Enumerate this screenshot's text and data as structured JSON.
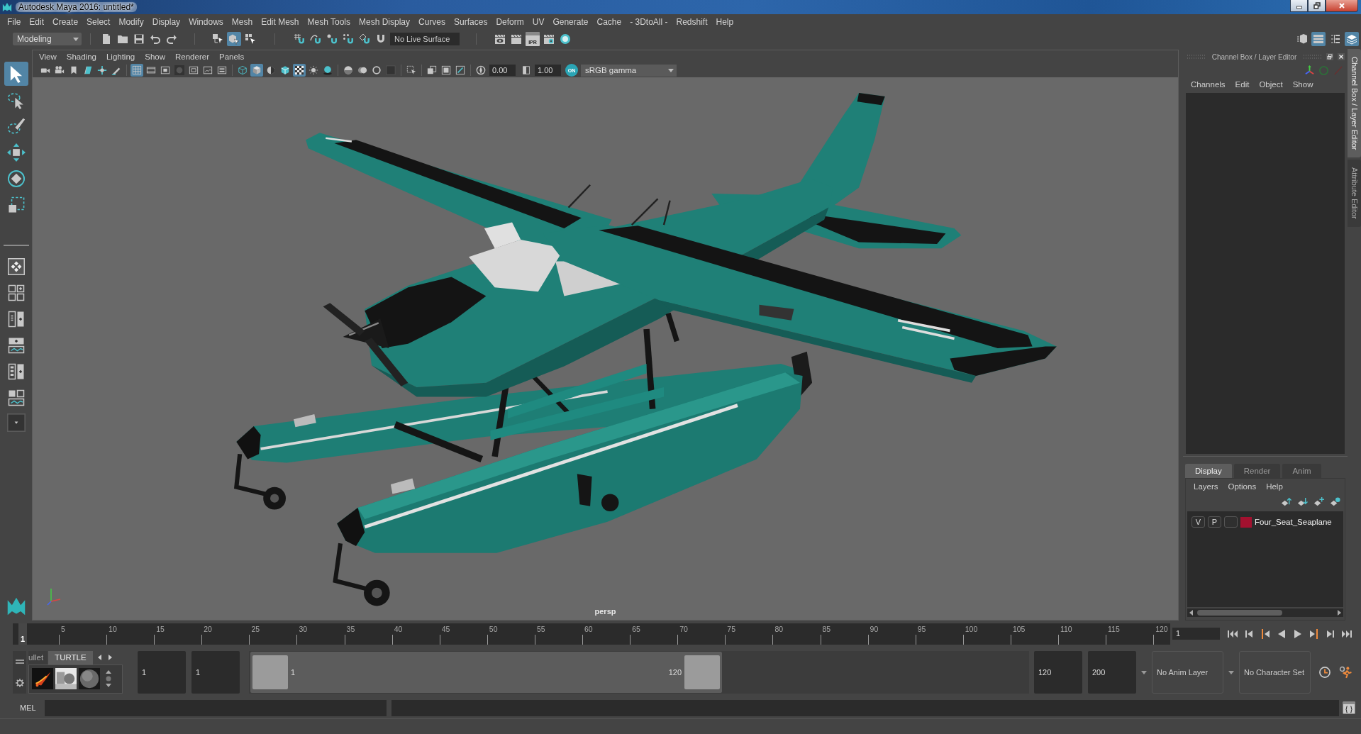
{
  "window": {
    "title": "Autodesk Maya 2016: untitled*"
  },
  "menu_bar": [
    "File",
    "Edit",
    "Create",
    "Select",
    "Modify",
    "Display",
    "Windows",
    "Mesh",
    "Edit Mesh",
    "Mesh Tools",
    "Mesh Display",
    "Curves",
    "Surfaces",
    "Deform",
    "UV",
    "Generate",
    "Cache",
    "- 3DtoAll -",
    "Redshift",
    "Help"
  ],
  "status_line": {
    "menu_set": "Modeling",
    "selection_modes": [
      {
        "kind": "hierarchy",
        "selected": false
      },
      {
        "kind": "object",
        "selected": true
      },
      {
        "kind": "component",
        "selected": false
      }
    ],
    "live_surface": "No Live Surface",
    "ipr_label": "IPR",
    "workspace_toggles": [
      {
        "kind": "modeling-toolkit",
        "selected": false
      },
      {
        "kind": "attribute-editor",
        "selected": true
      },
      {
        "kind": "tool-settings",
        "selected": false
      },
      {
        "kind": "channel-box",
        "selected": true
      }
    ]
  },
  "toolbox": {
    "tools": [
      {
        "kind": "select",
        "selected": true
      },
      {
        "kind": "lasso",
        "selected": false
      },
      {
        "kind": "paint",
        "selected": false
      },
      {
        "kind": "move",
        "selected": false
      },
      {
        "kind": "rotate",
        "selected": false
      },
      {
        "kind": "scale",
        "selected": false
      }
    ]
  },
  "viewport": {
    "menu": [
      "View",
      "Shading",
      "Lighting",
      "Show",
      "Renderer",
      "Panels"
    ],
    "toolbar_groups": [
      [
        {
          "kind": "camera",
          "selected": false
        },
        {
          "kind": "camera-attributes",
          "selected": false
        },
        {
          "kind": "bookmark",
          "selected": false
        },
        {
          "kind": "image-plane",
          "selected": false
        },
        {
          "kind": "pan-zoom",
          "selected": false
        },
        {
          "kind": "grease-pencil",
          "selected": false
        }
      ],
      [
        {
          "kind": "grid",
          "selected": true
        },
        {
          "kind": "film-gate",
          "selected": false
        },
        {
          "kind": "resolution-gate",
          "selected": false
        },
        {
          "kind": "gate-mask",
          "selected": false
        },
        {
          "kind": "field-chart",
          "selected": false
        },
        {
          "kind": "safe-action",
          "selected": false
        },
        {
          "kind": "safe-title",
          "selected": false
        }
      ],
      [
        {
          "kind": "wireframe",
          "selected": false
        },
        {
          "kind": "smooth-shade",
          "selected": true
        },
        {
          "kind": "default-material",
          "selected": false
        },
        {
          "kind": "wireframe-on-shaded",
          "selected": false
        },
        {
          "kind": "xray",
          "selected": true
        },
        {
          "kind": "lights",
          "selected": false
        },
        {
          "kind": "shadows",
          "selected": false
        }
      ],
      [
        {
          "kind": "ambient-occlusion",
          "selected": false
        },
        {
          "kind": "motion-blur",
          "selected": false
        },
        {
          "kind": "anti-aliasing",
          "selected": false
        },
        {
          "kind": "depth-of-field",
          "selected": false
        }
      ],
      [
        {
          "kind": "isolate-select",
          "selected": false
        }
      ],
      [
        {
          "kind": "xray-joints",
          "selected": false
        },
        {
          "kind": "xray-components",
          "selected": false
        },
        {
          "kind": "textures",
          "selected": false
        }
      ]
    ],
    "exposure": "0.00",
    "gamma": "1.00",
    "color_management": {
      "label": "ON",
      "on": true
    },
    "view_transform": "sRGB gamma",
    "camera": "persp"
  },
  "channel_box": {
    "title": "Channel Box / Layer Editor",
    "menu": [
      "Channels",
      "Edit",
      "Object",
      "Show"
    ]
  },
  "layer_editor": {
    "tabs": [
      {
        "label": "Display",
        "selected": true
      },
      {
        "label": "Render",
        "selected": false
      },
      {
        "label": "Anim",
        "selected": false
      }
    ],
    "menu": [
      "Layers",
      "Options",
      "Help"
    ],
    "layers": [
      {
        "visibility": "V",
        "playback": "P",
        "color": "#a3112f",
        "name": "Four_Seat_Seaplane"
      }
    ]
  },
  "side_tabs": [
    {
      "label": "Channel Box / Layer Editor",
      "selected": true
    },
    {
      "label": "Attribute Editor",
      "selected": false
    }
  ],
  "time_slider": {
    "ticks": [
      "5",
      "10",
      "15",
      "20",
      "25",
      "30",
      "35",
      "40",
      "45",
      "50",
      "55",
      "60",
      "65",
      "70",
      "75",
      "80",
      "85",
      "90",
      "95",
      "100",
      "105",
      "110",
      "115",
      "120"
    ],
    "level": 0,
    "current_frame_marker": "1",
    "current_frame": "1"
  },
  "shelf": {
    "tabs": [
      {
        "label": "ullet",
        "selected": false
      },
      {
        "label": "TURTLE",
        "selected": true
      }
    ]
  },
  "range_slider": {
    "animation_start": "1",
    "playback_start": "1",
    "range_start": "1",
    "range_end": "120",
    "playback_end": "120",
    "animation_end": "200",
    "anim_layer": "No Anim Layer",
    "character_set": "No Character Set"
  },
  "command_line": {
    "language": "MEL"
  }
}
